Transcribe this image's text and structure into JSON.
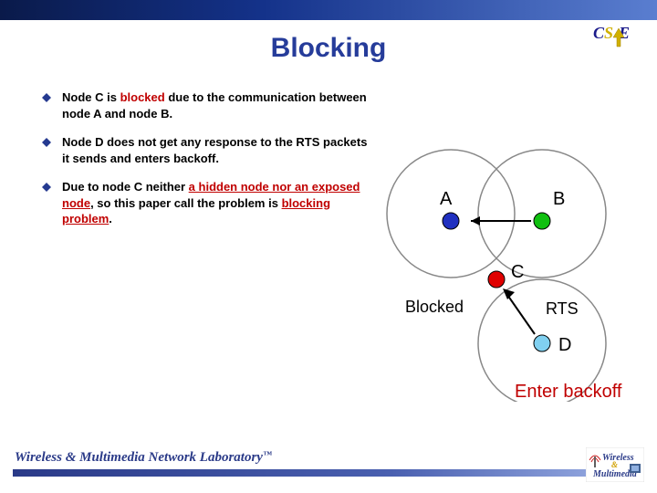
{
  "title": "Blocking",
  "bullets": [
    {
      "pre": "Node C is ",
      "em": "blocked",
      "post": " due to the communication between node A and node B."
    },
    {
      "pre": "Node D does not get any response to the RTS packets it sends and enters backoff.",
      "em": "",
      "post": ""
    },
    {
      "pre": "Due to node C neither ",
      "em": "a hidden node nor an exposed node",
      "post": ", so this paper call the problem is ",
      "em2": "blocking problem",
      "post2": "."
    }
  ],
  "diagram": {
    "labels": {
      "A": "A",
      "B": "B",
      "C": "C",
      "D": "D",
      "blocked": "Blocked",
      "rts": "RTS"
    },
    "backoff": "Enter backoff"
  },
  "footer": "Wireless & Multimedia Network Laboratory",
  "logo_top": {
    "c": "C",
    "s": "S",
    "e": "E"
  },
  "logo_bottom": {
    "l1": "Wireless",
    "amp": "&",
    "l2": "Multimedia"
  }
}
